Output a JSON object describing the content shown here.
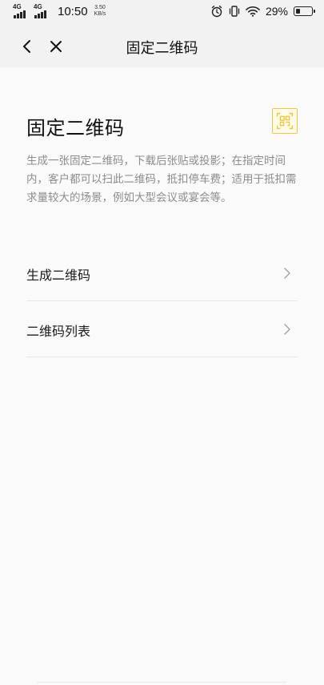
{
  "status_bar": {
    "network_1": "4G",
    "network_2": "4G",
    "time": "10:50",
    "speed_value": "3.50",
    "speed_unit": "KB/s",
    "battery_pct": "29%",
    "battery_level": 0.29
  },
  "nav": {
    "title": "固定二维码",
    "back_icon": "chevron-left-icon",
    "close_icon": "close-icon"
  },
  "main": {
    "heading": "固定二维码",
    "qr_icon": "qr-code-icon",
    "description": "生成一张固定二维码，下载后张贴或投影；在指定时间内，客户都可以扫此二维码，抵扣停车费；适用于抵扣需求量较大的场景，例如大型会议或宴会等。"
  },
  "menu": [
    {
      "label": "生成二维码"
    },
    {
      "label": "二维码列表"
    }
  ],
  "colors": {
    "accent": "#f0c640",
    "text_secondary": "#8c8c8c"
  }
}
